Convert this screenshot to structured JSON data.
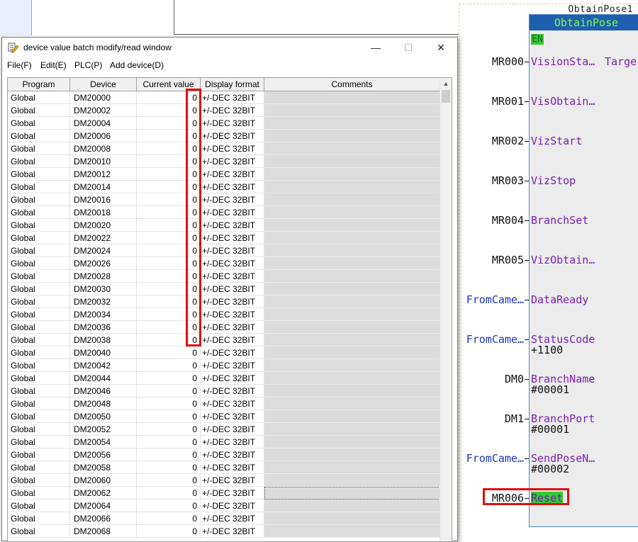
{
  "window": {
    "title": "device value batch modify/read window",
    "minimize": "—",
    "maximize": "☐",
    "close": "✕"
  },
  "menu": [
    "File(F)",
    "Edit(E)",
    "PLC(P)",
    "Add device(D)"
  ],
  "columns": [
    "Program",
    "Device",
    "Current value",
    "Display format",
    "Comments"
  ],
  "rows": [
    {
      "program": "Global",
      "device": "DM20000",
      "value": "0",
      "format": "+/-DEC 32BIT",
      "comment": ""
    },
    {
      "program": "Global",
      "device": "DM20002",
      "value": "0",
      "format": "+/-DEC 32BIT",
      "comment": ""
    },
    {
      "program": "Global",
      "device": "DM20004",
      "value": "0",
      "format": "+/-DEC 32BIT",
      "comment": ""
    },
    {
      "program": "Global",
      "device": "DM20006",
      "value": "0",
      "format": "+/-DEC 32BIT",
      "comment": ""
    },
    {
      "program": "Global",
      "device": "DM20008",
      "value": "0",
      "format": "+/-DEC 32BIT",
      "comment": ""
    },
    {
      "program": "Global",
      "device": "DM20010",
      "value": "0",
      "format": "+/-DEC 32BIT",
      "comment": ""
    },
    {
      "program": "Global",
      "device": "DM20012",
      "value": "0",
      "format": "+/-DEC 32BIT",
      "comment": ""
    },
    {
      "program": "Global",
      "device": "DM20014",
      "value": "0",
      "format": "+/-DEC 32BIT",
      "comment": ""
    },
    {
      "program": "Global",
      "device": "DM20016",
      "value": "0",
      "format": "+/-DEC 32BIT",
      "comment": ""
    },
    {
      "program": "Global",
      "device": "DM20018",
      "value": "0",
      "format": "+/-DEC 32BIT",
      "comment": ""
    },
    {
      "program": "Global",
      "device": "DM20020",
      "value": "0",
      "format": "+/-DEC 32BIT",
      "comment": ""
    },
    {
      "program": "Global",
      "device": "DM20022",
      "value": "0",
      "format": "+/-DEC 32BIT",
      "comment": ""
    },
    {
      "program": "Global",
      "device": "DM20024",
      "value": "0",
      "format": "+/-DEC 32BIT",
      "comment": ""
    },
    {
      "program": "Global",
      "device": "DM20026",
      "value": "0",
      "format": "+/-DEC 32BIT",
      "comment": ""
    },
    {
      "program": "Global",
      "device": "DM20028",
      "value": "0",
      "format": "+/-DEC 32BIT",
      "comment": ""
    },
    {
      "program": "Global",
      "device": "DM20030",
      "value": "0",
      "format": "+/-DEC 32BIT",
      "comment": ""
    },
    {
      "program": "Global",
      "device": "DM20032",
      "value": "0",
      "format": "+/-DEC 32BIT",
      "comment": ""
    },
    {
      "program": "Global",
      "device": "DM20034",
      "value": "0",
      "format": "+/-DEC 32BIT",
      "comment": ""
    },
    {
      "program": "Global",
      "device": "DM20036",
      "value": "0",
      "format": "+/-DEC 32BIT",
      "comment": ""
    },
    {
      "program": "Global",
      "device": "DM20038",
      "value": "0",
      "format": "+/-DEC 32BIT",
      "comment": ""
    },
    {
      "program": "Global",
      "device": "DM20040",
      "value": "0",
      "format": "+/-DEC 32BIT",
      "comment": ""
    },
    {
      "program": "Global",
      "device": "DM20042",
      "value": "0",
      "format": "+/-DEC 32BIT",
      "comment": ""
    },
    {
      "program": "Global",
      "device": "DM20044",
      "value": "0",
      "format": "+/-DEC 32BIT",
      "comment": ""
    },
    {
      "program": "Global",
      "device": "DM20046",
      "value": "0",
      "format": "+/-DEC 32BIT",
      "comment": ""
    },
    {
      "program": "Global",
      "device": "DM20048",
      "value": "0",
      "format": "+/-DEC 32BIT",
      "comment": ""
    },
    {
      "program": "Global",
      "device": "DM20050",
      "value": "0",
      "format": "+/-DEC 32BIT",
      "comment": ""
    },
    {
      "program": "Global",
      "device": "DM20052",
      "value": "0",
      "format": "+/-DEC 32BIT",
      "comment": ""
    },
    {
      "program": "Global",
      "device": "DM20054",
      "value": "0",
      "format": "+/-DEC 32BIT",
      "comment": ""
    },
    {
      "program": "Global",
      "device": "DM20056",
      "value": "0",
      "format": "+/-DEC 32BIT",
      "comment": ""
    },
    {
      "program": "Global",
      "device": "DM20058",
      "value": "0",
      "format": "+/-DEC 32BIT",
      "comment": ""
    },
    {
      "program": "Global",
      "device": "DM20060",
      "value": "0",
      "format": "+/-DEC 32BIT",
      "comment": ""
    },
    {
      "program": "Global",
      "device": "DM20062",
      "value": "0",
      "format": "+/-DEC 32BIT",
      "comment": "",
      "selected": true
    },
    {
      "program": "Global",
      "device": "DM20064",
      "value": "0",
      "format": "+/-DEC 32BIT",
      "comment": ""
    },
    {
      "program": "Global",
      "device": "DM20066",
      "value": "0",
      "format": "+/-DEC 32BIT",
      "comment": ""
    },
    {
      "program": "Global",
      "device": "DM20068",
      "value": "0",
      "format": "+/-DEC 32BIT",
      "comment": ""
    }
  ],
  "ladder": {
    "instance": "ObtainPose1",
    "block_name": "ObtainPose",
    "en_label": "EN",
    "target_label": "Targe",
    "pins": [
      {
        "operand": "MR000",
        "label": "VisionSta…",
        "value": "",
        "operand_color": "black"
      },
      {
        "operand": "MR001",
        "label": "VisObtain…",
        "value": "",
        "operand_color": "black"
      },
      {
        "operand": "MR002",
        "label": "VizStart",
        "value": "",
        "operand_color": "black"
      },
      {
        "operand": "MR003",
        "label": "VizStop",
        "value": "",
        "operand_color": "black"
      },
      {
        "operand": "MR004",
        "label": "BranchSet",
        "value": "",
        "operand_color": "black"
      },
      {
        "operand": "MR005",
        "label": "VizObtain…",
        "value": "",
        "operand_color": "black"
      },
      {
        "operand": "FromCame…",
        "label": "DataReady",
        "value": "",
        "operand_color": "blue"
      },
      {
        "operand": "FromCame…",
        "label": "StatusCode",
        "value": "+1100",
        "operand_color": "blue"
      },
      {
        "operand": "DM0",
        "label": "BranchName",
        "value": "#00001",
        "operand_color": "black"
      },
      {
        "operand": "DM1",
        "label": "BranchPort",
        "value": "#00001",
        "operand_color": "black"
      },
      {
        "operand": "FromCame…",
        "label": "SendPoseN…",
        "value": "#00002",
        "operand_color": "blue"
      },
      {
        "operand": "MR006",
        "label": "Reset",
        "value": "",
        "operand_color": "black"
      }
    ]
  },
  "colors": {
    "highlight_red": "#e01010",
    "fb_header_blue": "#1e5fae",
    "fb_title_green": "#7cfc45",
    "pin_label_purple": "#7a1fb3",
    "comment_cell_gray": "#dcdcdc"
  }
}
